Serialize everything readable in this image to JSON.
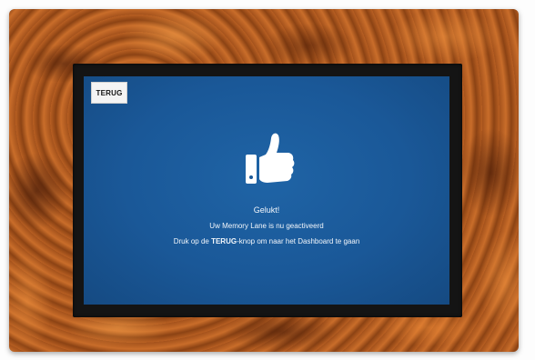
{
  "screen": {
    "back_button": "TERUG",
    "title": "Gelukt!",
    "line1": "Uw Memory Lane is nu geactiveerd",
    "line2_before": "Druk op de ",
    "line2_bold": "TERUG",
    "line2_after": "-knop om naar het Dashboard te gaan",
    "icon": "thumbs-up-icon"
  },
  "colors": {
    "screen_blue": "#1a5898",
    "text": "#f2f6fb",
    "wood": "#b35a1f",
    "bezel": "#141414"
  }
}
